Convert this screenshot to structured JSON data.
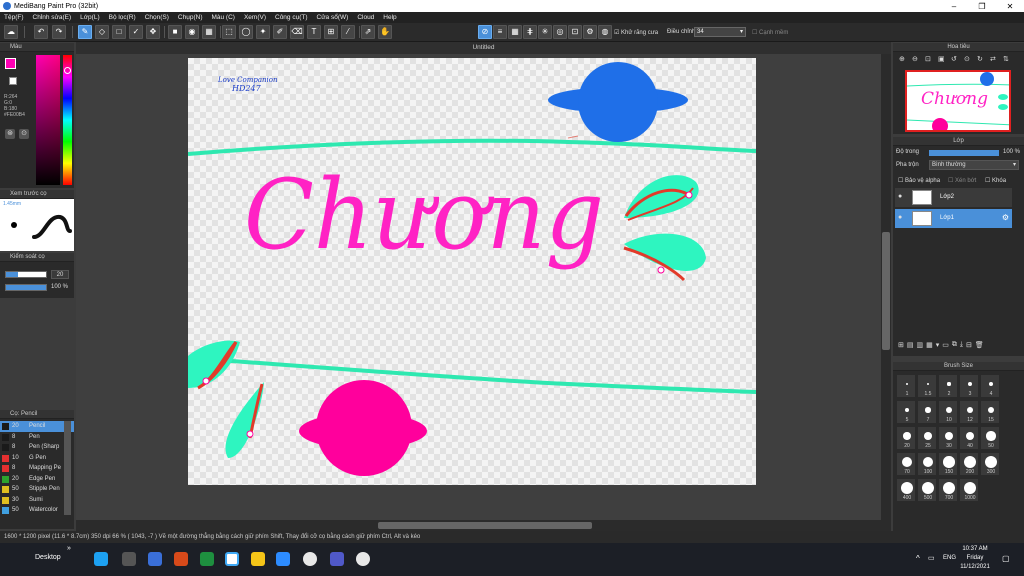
{
  "window": {
    "title": "MediBang Paint Pro (32bit)",
    "minimize": "–",
    "restore": "❐",
    "close": "✕"
  },
  "menu": [
    "Tệp(F)",
    "Chỉnh sửa(E)",
    "Lớp(L)",
    "Bộ lọc(R)",
    "Chọn(S)",
    "Chụp(N)",
    "Màu (C)",
    "Xem(V)",
    "Công cụ(T)",
    "Cửa sổ(W)",
    "Cloud",
    "Help"
  ],
  "toolbar": {
    "antialias_label": "Khử răng cưa",
    "correction_label": "Điều chỉnh",
    "correction_value": "34",
    "edge_label": "Cạnh mềm"
  },
  "color_panel": {
    "title": "Màu",
    "r": "R:264",
    "g": "G:0",
    "b": "B:180",
    "hex": "#FE00B4",
    "primary_color": "#fe00b4"
  },
  "brush_preview": {
    "title": "Xem trước cọ",
    "size": "1.45mm"
  },
  "brush_control": {
    "title": "Kiểm soát cọ",
    "size_value": "20",
    "opacity_value": "100 %"
  },
  "brush_list": {
    "title": "Cọ: Pencil",
    "items": [
      {
        "size": "20",
        "name": "Pencil",
        "color": "#1a1a1a",
        "selected": true
      },
      {
        "size": "8",
        "name": "Pen",
        "color": "#1a1a1a"
      },
      {
        "size": "8",
        "name": "Pen (Sharp",
        "color": "#1a1a1a"
      },
      {
        "size": "10",
        "name": "G Pen",
        "color": "#e53030"
      },
      {
        "size": "8",
        "name": "Mapping Pe",
        "color": "#e53030"
      },
      {
        "size": "20",
        "name": "Edge Pen",
        "color": "#2ea32e"
      },
      {
        "size": "50",
        "name": "Stipple Pen",
        "color": "#e0c020"
      },
      {
        "size": "30",
        "name": "Sumi",
        "color": "#e0c020"
      },
      {
        "size": "50",
        "name": "Watercolor",
        "color": "#40a0e0"
      }
    ]
  },
  "document": {
    "tab": "Untitled",
    "signature_line1": "Love Companion",
    "signature_line2": "HD247",
    "title_text": "Chương"
  },
  "navigator": {
    "title": "Hoa tiêu",
    "preview_text": "Chương"
  },
  "layer_panel": {
    "title": "Lớp",
    "opacity_label": "Độ trong",
    "opacity_value": "100 %",
    "blend_label": "Pha trộn",
    "blend_value": "Bình thường",
    "protect_alpha": "Bảo vệ alpha",
    "clipping": "Xén bớt",
    "lock": "Khóa",
    "layers": [
      {
        "name": "Lớp2",
        "selected": false
      },
      {
        "name": "Lớp1",
        "selected": true
      }
    ]
  },
  "brush_size_panel": {
    "title": "Brush Size",
    "sizes": [
      "1",
      "1.5",
      "2",
      "3",
      "4",
      "5",
      "7",
      "10",
      "12",
      "15",
      "20",
      "25",
      "30",
      "40",
      "50",
      "70",
      "100",
      "150",
      "200",
      "300",
      "400",
      "500",
      "700",
      "1000"
    ]
  },
  "status": {
    "text": "1600 * 1200 pixel   (11.6 * 8.7cm)   350 dpi   66 %   ( 1043, -7 )   Vẽ một đường thẳng bằng cách giữ phím Shift, Thay đổi cỡ cọ bằng cách giữ phím Ctrl, Alt và kéo"
  },
  "taskbar": {
    "desktop_label": "Desktop",
    "chevron": "»",
    "tray_chevron": "^",
    "lang": "ENG",
    "time": "10:37 AM",
    "day": "Friday",
    "date": "11/12/2021"
  }
}
